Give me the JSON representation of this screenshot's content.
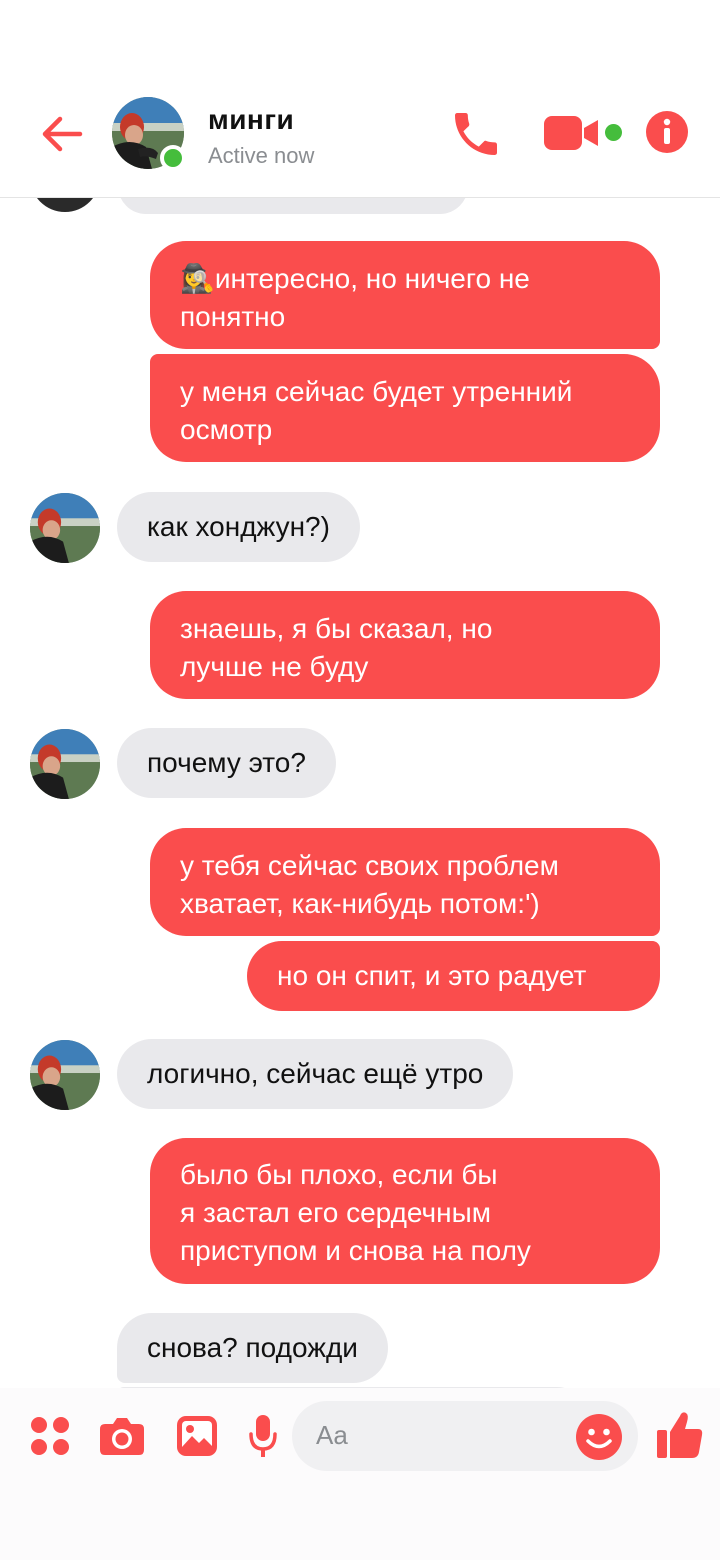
{
  "header": {
    "name": "минги",
    "status": "Active now"
  },
  "colors": {
    "accent": "#fa4d4d",
    "incoming_bubble": "#e9e9ec",
    "online": "#45bd3c"
  },
  "icons": {
    "back": "arrow-left-icon",
    "call": "phone-icon",
    "video": "video-camera-icon",
    "info": "info-icon",
    "apps": "four-dots-icon",
    "camera": "camera-icon",
    "gallery": "image-icon",
    "mic": "microphone-icon",
    "emoji": "smiley-icon",
    "like": "thumbs-up-icon"
  },
  "messages": [
    {
      "dir": "out",
      "text": "🕵️‍♀️интересно, но ничего не\nпонятно"
    },
    {
      "dir": "out",
      "text": "у меня сейчас будет утренний\nосмотр"
    },
    {
      "dir": "in",
      "text": "как хонджун?)"
    },
    {
      "dir": "out",
      "text": "знаешь, я бы сказал, но\nлучше не буду"
    },
    {
      "dir": "in",
      "text": "почему это?"
    },
    {
      "dir": "out",
      "text": "у тебя сейчас своих проблем\nхватает, как-нибудь потом:')"
    },
    {
      "dir": "out",
      "text": "но он спит, и это радует"
    },
    {
      "dir": "in",
      "text": "логично, сейчас ещё утро"
    },
    {
      "dir": "out",
      "text": "было бы плохо, если бы\nя застал его сердечным\nприступом и снова на полу"
    },
    {
      "dir": "in",
      "text": "снова? подожди"
    }
  ],
  "composer": {
    "placeholder": "Aa"
  }
}
